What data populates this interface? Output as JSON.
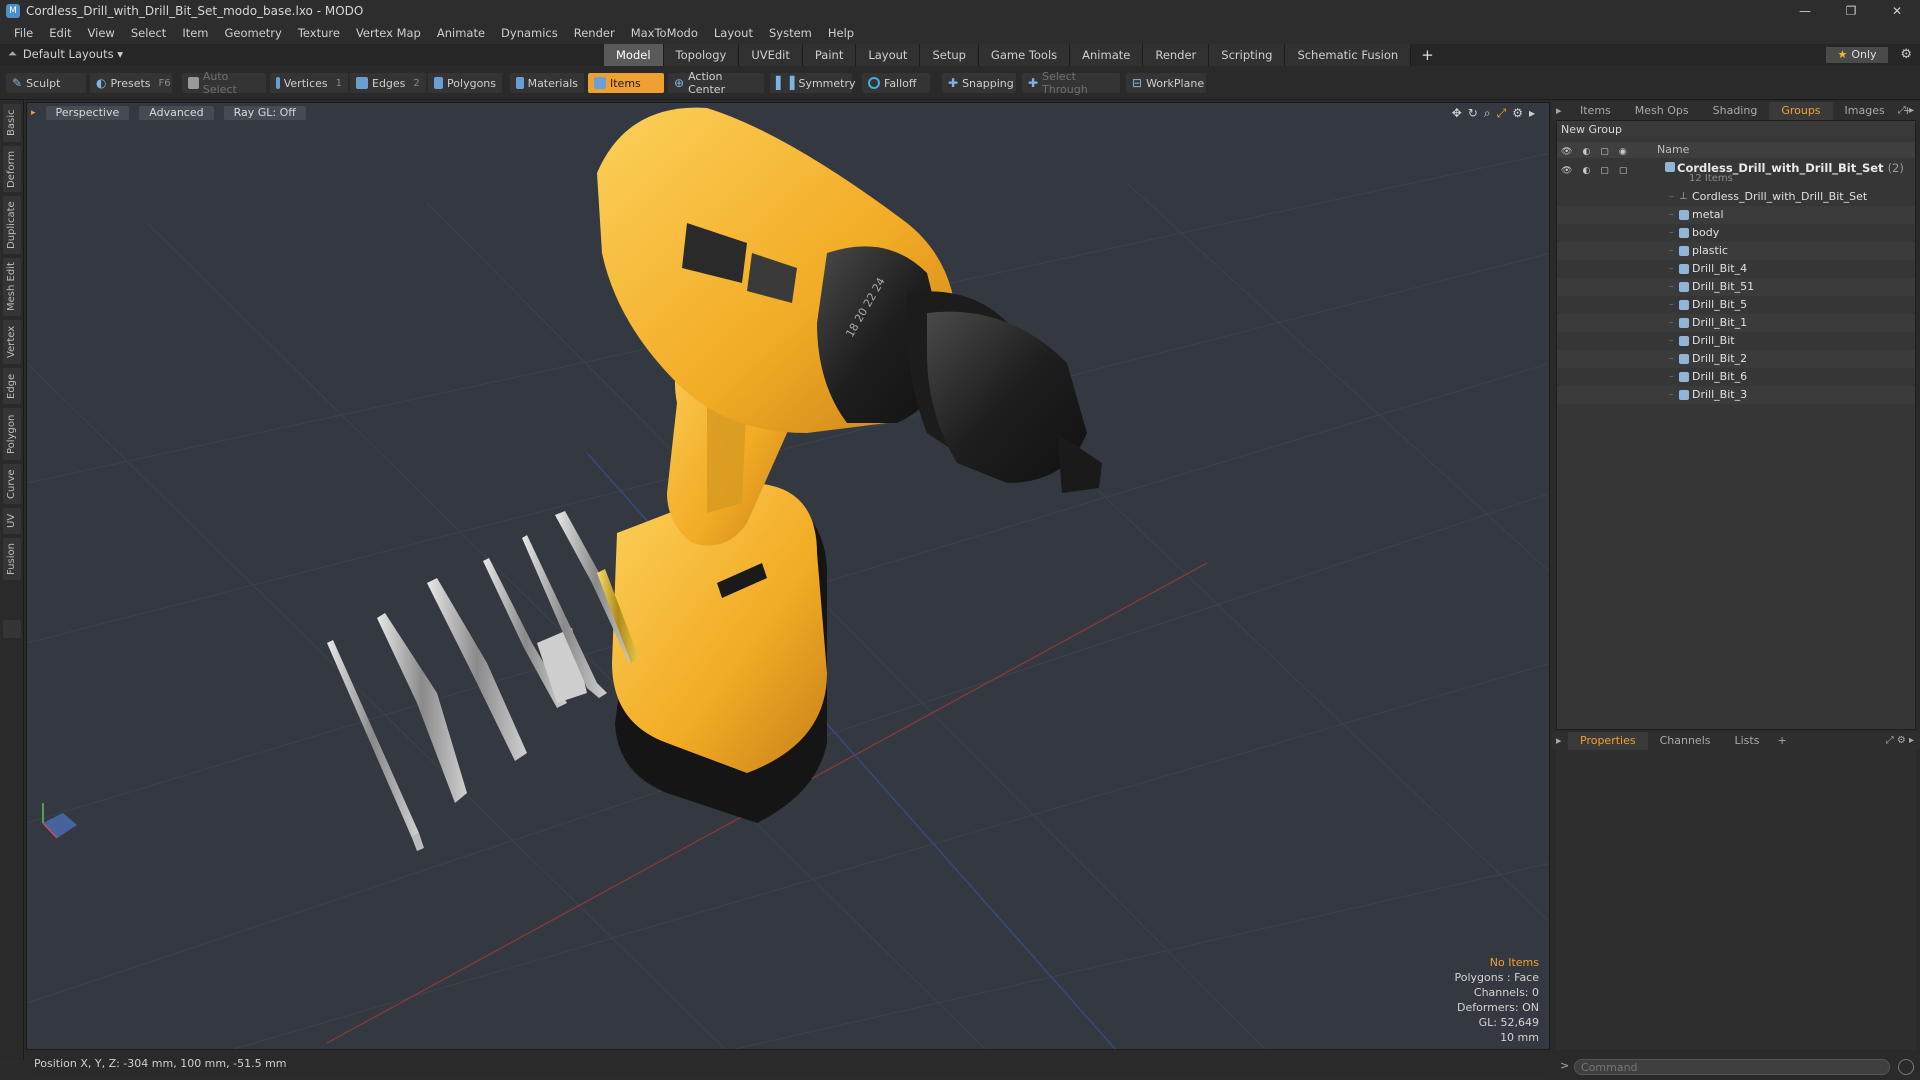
{
  "window": {
    "title": "Cordless_Drill_with_Drill_Bit_Set_modo_base.lxo - MODO",
    "controls": [
      "—",
      "❐",
      "✕"
    ]
  },
  "menu": [
    "File",
    "Edit",
    "View",
    "Select",
    "Item",
    "Geometry",
    "Texture",
    "Vertex Map",
    "Animate",
    "Dynamics",
    "Render",
    "MaxToModo",
    "Layout",
    "System",
    "Help"
  ],
  "layout_bar": {
    "layout_selector": "Default Layouts ▾",
    "tabs": [
      "Model",
      "Topology",
      "UVEdit",
      "Paint",
      "Layout",
      "Setup",
      "Game Tools",
      "Animate",
      "Render",
      "Scripting",
      "Schematic Fusion"
    ],
    "active_tab": "Model",
    "add_label": "+",
    "only_label": "Only"
  },
  "toolbar": {
    "sculpt": "Sculpt",
    "presets": "Presets",
    "presets_key": "F6",
    "auto_select": "Auto Select",
    "vertices": "Vertices",
    "vertices_count": "1",
    "edges": "Edges",
    "edges_count": "2",
    "polygons": "Polygons",
    "materials": "Materials",
    "items": "Items",
    "action_center": "Action Center",
    "symmetry": "Symmetry",
    "falloff": "Falloff",
    "snapping": "Snapping",
    "select_through": "Select Through",
    "workplane": "WorkPlane"
  },
  "left_tabs": [
    "Basic",
    "Deform",
    "Duplicate",
    "Mesh Edit",
    "Vertex",
    "Edge",
    "Polygon",
    "Curve",
    "UV",
    "Fusion"
  ],
  "viewport": {
    "view": "Perspective",
    "mode": "Advanced",
    "raygl": "Ray GL: Off",
    "info": {
      "selection": "No Items",
      "polygons": "Polygons : Face",
      "channels": "Channels: 0",
      "deformers": "Deformers: ON",
      "gl": "GL: 52,649",
      "scale": "10 mm"
    },
    "drill_dial": "18 20 22 24"
  },
  "status": {
    "position": "Position X, Y, Z:  -304 mm, 100 mm, -51.5 mm"
  },
  "right_panel": {
    "top_tabs": [
      "Items",
      "Mesh Ops",
      "Shading",
      "Groups",
      "Images"
    ],
    "active_top_tab": "Groups",
    "add_label": "+",
    "new_group": "New Group",
    "name_header": "Name",
    "group": {
      "name": "Cordless_Drill_with_Drill_Bit_Set",
      "count": "(2)",
      "subtitle": "12 Items"
    },
    "items": [
      {
        "label": "Cordless_Drill_with_Drill_Bit_Set",
        "kind": "locator"
      },
      {
        "label": "metal",
        "kind": "mesh"
      },
      {
        "label": "body",
        "kind": "mesh"
      },
      {
        "label": "plastic",
        "kind": "mesh"
      },
      {
        "label": "Drill_Bit_4",
        "kind": "mesh"
      },
      {
        "label": "Drill_Bit_51",
        "kind": "mesh"
      },
      {
        "label": "Drill_Bit_5",
        "kind": "mesh"
      },
      {
        "label": "Drill_Bit_1",
        "kind": "mesh"
      },
      {
        "label": "Drill_Bit",
        "kind": "mesh"
      },
      {
        "label": "Drill_Bit_2",
        "kind": "mesh"
      },
      {
        "label": "Drill_Bit_6",
        "kind": "mesh"
      },
      {
        "label": "Drill_Bit_3",
        "kind": "mesh"
      }
    ],
    "bottom_tabs": [
      "Properties",
      "Channels",
      "Lists"
    ],
    "active_bottom_tab": "Properties",
    "command_placeholder": "Command"
  },
  "colors": {
    "accent": "#f0a030",
    "drill_body": "#f2b12f",
    "viewport_bg": "#343941"
  }
}
